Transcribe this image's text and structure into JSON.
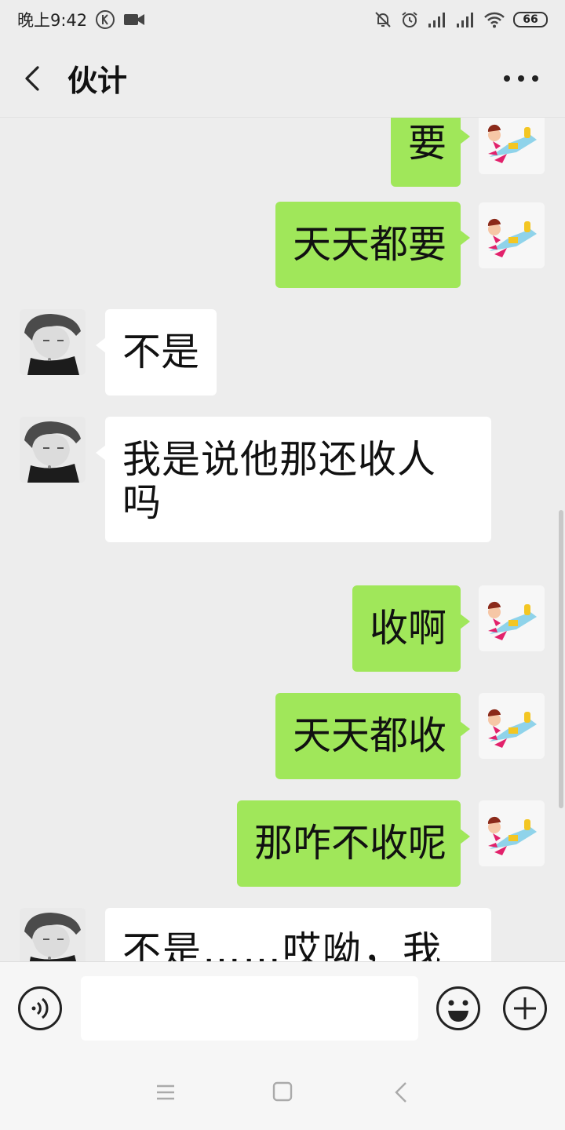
{
  "status_bar": {
    "time": "晚上9:42",
    "battery": "66",
    "left_icons": [
      "k-circle-icon",
      "video-icon"
    ],
    "right_icons": [
      "mute-bell-icon",
      "alarm-icon",
      "signal-icon",
      "signal-icon",
      "wifi-icon",
      "battery-icon"
    ]
  },
  "header": {
    "title": "伙计",
    "back_icon": "chevron-left-icon",
    "more_icon": "more-dots-icon"
  },
  "messages": [
    {
      "sender": "self",
      "text": "要"
    },
    {
      "sender": "self",
      "text": "天天都要"
    },
    {
      "sender": "other",
      "text": "不是"
    },
    {
      "sender": "other",
      "text": "我是说他那还收人吗"
    },
    {
      "sender": "self",
      "text": "收啊"
    },
    {
      "sender": "self",
      "text": "天天都收"
    },
    {
      "sender": "self",
      "text": "那咋不收呢"
    },
    {
      "sender": "other",
      "text": "不是……哎呦，我是"
    }
  ],
  "input_bar": {
    "voice_icon": "voice-icon",
    "text_value": "",
    "emoji_icon": "emoji-icon",
    "plus_icon": "plus-icon"
  },
  "nav_bar": {
    "icons": [
      "menu-icon",
      "home-square-icon",
      "back-triangle-icon"
    ]
  },
  "colors": {
    "background": "#ededed",
    "self_bubble": "#a0e75a",
    "other_bubble": "#ffffff"
  }
}
